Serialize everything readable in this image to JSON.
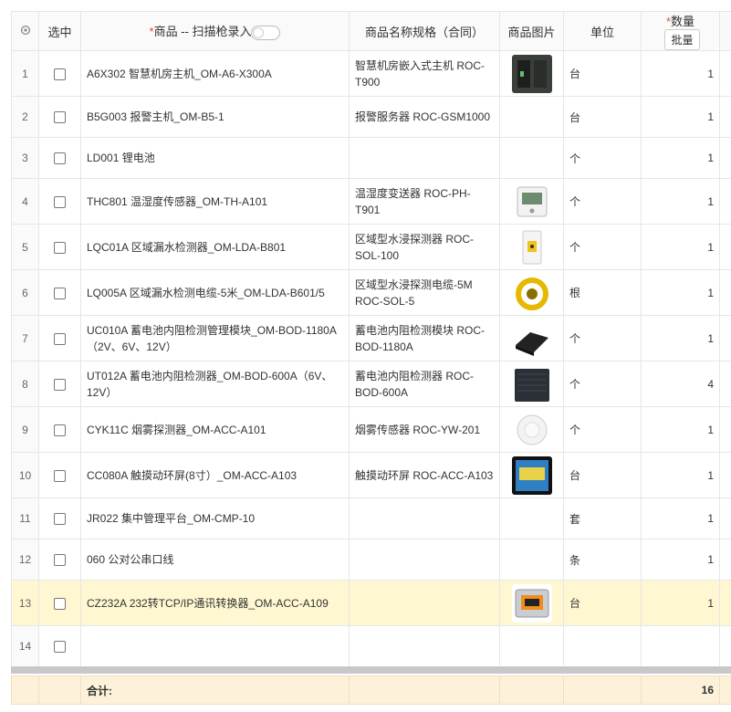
{
  "header": {
    "select_label": "选中",
    "product_label": "商品 -- 扫描枪录入",
    "spec_label": "商品名称规格（合同）",
    "image_label": "商品图片",
    "unit_label": "单位",
    "qty_label": "数量",
    "batch_label": "批量",
    "required_mark": "*"
  },
  "rows": [
    {
      "n": "1",
      "name": "A6X302 智慧机房主机_OM-A6-X300A",
      "spec": "智慧机房嵌入式主机 ROC-T900",
      "unit": "台",
      "qty": "1",
      "img": "server"
    },
    {
      "n": "2",
      "name": "B5G003 报警主机_OM-B5-1",
      "spec": "报警服务器 ROC-GSM1000",
      "unit": "台",
      "qty": "1",
      "img": ""
    },
    {
      "n": "3",
      "name": "LD001 锂电池",
      "spec": "",
      "unit": "个",
      "qty": "1",
      "img": ""
    },
    {
      "n": "4",
      "name": "THC801 温湿度传感器_OM-TH-A101",
      "spec": "温湿度变送器 ROC-PH-T901",
      "unit": "个",
      "qty": "1",
      "img": "thermo"
    },
    {
      "n": "5",
      "name": "LQC01A 区域漏水检测器_OM-LDA-B801",
      "spec": "区域型水浸探测器 ROC-SOL-100",
      "unit": "个",
      "qty": "1",
      "img": "leak"
    },
    {
      "n": "6",
      "name": "LQ005A 区域漏水检测电缆-5米_OM-LDA-B601/5",
      "spec": "区域型水浸探测电缆-5M ROC-SOL-5",
      "unit": "根",
      "qty": "1",
      "img": "cable"
    },
    {
      "n": "7",
      "name": "UC010A 蓄电池内阻检测管理模块_OM-BOD-1180A（2V、6V、12V）",
      "spec": "蓄电池内阻检测模块 ROC-BOD-1180A",
      "unit": "个",
      "qty": "1",
      "img": "module"
    },
    {
      "n": "8",
      "name": "UT012A 蓄电池内阻检测器_OM-BOD-600A（6V、12V）",
      "spec": "蓄电池内阻检测器 ROC-BOD-600A",
      "unit": "个",
      "qty": "4",
      "img": "box"
    },
    {
      "n": "9",
      "name": "CYK11C 烟雾探测器_OM-ACC-A101",
      "spec": "烟雾传感器 ROC-YW-201",
      "unit": "个",
      "qty": "1",
      "img": "smoke"
    },
    {
      "n": "10",
      "name": "CC080A 触摸动环屏(8寸）_OM-ACC-A103",
      "spec": "触摸动环屏 ROC-ACC-A103",
      "unit": "台",
      "qty": "1",
      "img": "screen"
    },
    {
      "n": "11",
      "name": "JR022 集中管理平台_OM-CMP-10",
      "spec": "",
      "unit": "套",
      "qty": "1",
      "img": ""
    },
    {
      "n": "12",
      "name": "060 公对公串口线",
      "spec": "",
      "unit": "条",
      "qty": "1",
      "img": ""
    },
    {
      "n": "13",
      "name": "CZ232A 232转TCP/IP通讯转换器_OM-ACC-A109",
      "spec": "",
      "unit": "台",
      "qty": "1",
      "img": "converter"
    },
    {
      "n": "14",
      "name": "",
      "spec": "",
      "unit": "",
      "qty": "",
      "img": ""
    }
  ],
  "footer": {
    "total_label": "合计:",
    "total_qty": "16"
  },
  "colors": {
    "selected_row": "#fff7d1",
    "footer_bg": "#fdf2d9",
    "required": "#e64545"
  }
}
